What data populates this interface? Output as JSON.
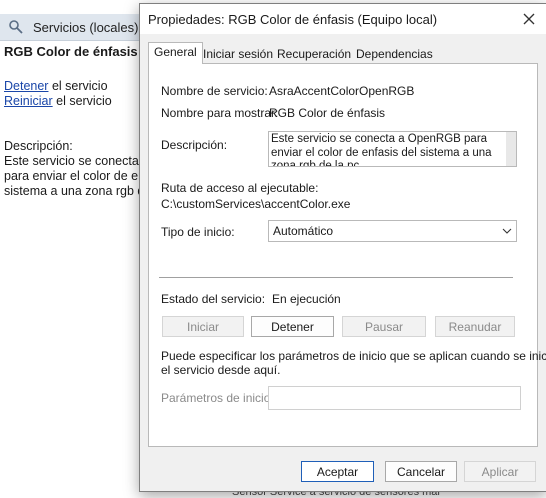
{
  "console": {
    "tree_label": "Servicios (locales)",
    "service_name": "RGB Color de énfasis",
    "stop_link": "Detener",
    "stop_suffix": " el servicio",
    "restart_link": "Reiniciar",
    "restart_suffix": " el servicio",
    "description_label": "Descripción:",
    "description_lines": [
      "Este servicio se conecta a",
      "para enviar el color de ent",
      "sistema a una zona rgb de"
    ],
    "bottom_partial": "Sensor Service                          a servicio de sensores mar"
  },
  "dialog": {
    "title": "Propiedades: RGB Color de énfasis (Equipo local)",
    "tabs": [
      {
        "label": "General"
      },
      {
        "label": "Iniciar sesión"
      },
      {
        "label": "Recuperación"
      },
      {
        "label": "Dependencias"
      }
    ],
    "service_name_label": "Nombre de servicio:",
    "service_name_value": "AsraAccentColorOpenRGB",
    "display_name_label": "Nombre para mostrar:",
    "display_name_value": "RGB Color de énfasis",
    "description_label": "Descripción:",
    "description_value": "Este servicio se conecta a OpenRGB para enviar el color de enfasis del sistema a una zona rgb de la pc",
    "path_label": "Ruta de acceso al ejecutable:",
    "path_value": "C:\\customServices\\accentColor.exe",
    "startup_type_label": "Tipo de inicio:",
    "startup_type_value": "Automático",
    "status_label": "Estado del servicio:",
    "status_value": "En ejecución",
    "buttons": {
      "start": "Iniciar",
      "stop": "Detener",
      "pause": "Pausar",
      "resume": "Reanudar"
    },
    "hint_text_line1": "Puede especificar los parámetros de inicio que se aplican cuando se inicia",
    "hint_text_line2": "el servicio desde aquí.",
    "params_label": "Parámetros de inicio:",
    "params_value": "",
    "footer": {
      "ok": "Aceptar",
      "cancel": "Cancelar",
      "apply": "Aplicar"
    }
  },
  "colors": {
    "accent_border": "#1f5fb8",
    "link": "#1a46a8"
  }
}
